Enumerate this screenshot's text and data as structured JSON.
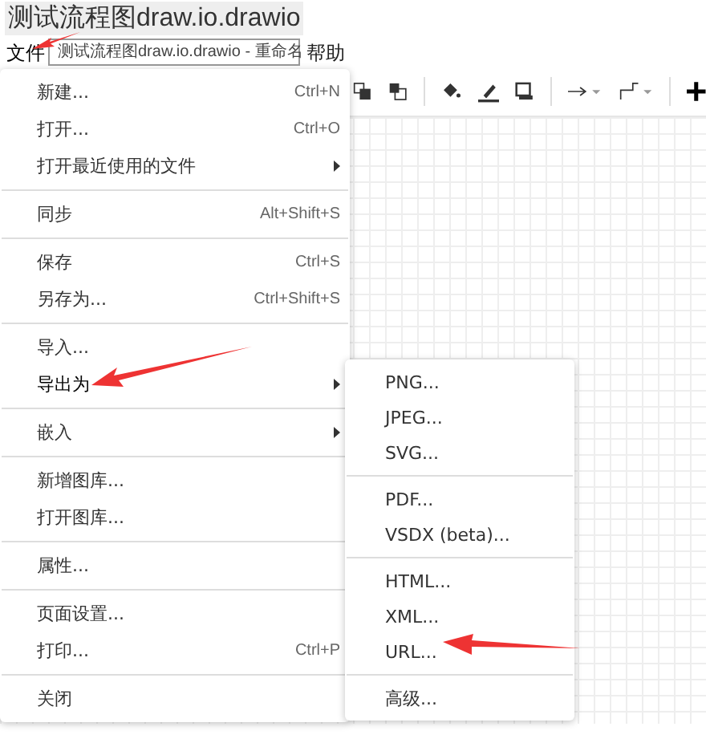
{
  "window": {
    "title": "测试流程图draw.io.drawio"
  },
  "menubar": [
    {
      "label": "文件",
      "selected": true
    },
    {
      "label": "帮助",
      "selected": false
    }
  ],
  "rename_tooltip": "测试流程图draw.io.drawio - 重命名",
  "file_menu": [
    {
      "kind": "item",
      "label": "新建...",
      "shortcut": "Ctrl+N",
      "submenu": false,
      "selected": false
    },
    {
      "kind": "item",
      "label": "打开...",
      "shortcut": "Ctrl+O",
      "submenu": false,
      "selected": false
    },
    {
      "kind": "item",
      "label": "打开最近使用的文件",
      "submenu": true,
      "selected": false
    },
    {
      "kind": "separator"
    },
    {
      "kind": "item",
      "label": "同步",
      "shortcut": "Alt+Shift+S",
      "submenu": false,
      "selected": false
    },
    {
      "kind": "separator"
    },
    {
      "kind": "item",
      "label": "保存",
      "shortcut": "Ctrl+S",
      "submenu": false,
      "selected": false
    },
    {
      "kind": "item",
      "label": "另存为...",
      "shortcut": "Ctrl+Shift+S",
      "submenu": false,
      "selected": false
    },
    {
      "kind": "separator"
    },
    {
      "kind": "item",
      "label": "导入...",
      "submenu": false,
      "selected": false
    },
    {
      "kind": "item",
      "label": "导出为",
      "submenu": true,
      "selected": true
    },
    {
      "kind": "separator"
    },
    {
      "kind": "item",
      "label": "嵌入",
      "submenu": true,
      "selected": false
    },
    {
      "kind": "separator"
    },
    {
      "kind": "item",
      "label": "新增图库...",
      "submenu": false,
      "selected": false
    },
    {
      "kind": "item",
      "label": "打开图库...",
      "submenu": false,
      "selected": false
    },
    {
      "kind": "separator"
    },
    {
      "kind": "item",
      "label": "属性...",
      "submenu": false,
      "selected": false
    },
    {
      "kind": "separator"
    },
    {
      "kind": "item",
      "label": "页面设置...",
      "submenu": false,
      "selected": false
    },
    {
      "kind": "item",
      "label": "打印...",
      "shortcut": "Ctrl+P",
      "submenu": false,
      "selected": false
    },
    {
      "kind": "separator"
    },
    {
      "kind": "item",
      "label": "关闭",
      "submenu": false,
      "selected": false
    }
  ],
  "export_menu": [
    {
      "kind": "item",
      "label": "PNG..."
    },
    {
      "kind": "item",
      "label": "JPEG..."
    },
    {
      "kind": "item",
      "label": "SVG..."
    },
    {
      "kind": "separator"
    },
    {
      "kind": "item",
      "label": "PDF..."
    },
    {
      "kind": "item",
      "label": "VSDX (beta)..."
    },
    {
      "kind": "separator"
    },
    {
      "kind": "item",
      "label": "HTML..."
    },
    {
      "kind": "item",
      "label": "XML..."
    },
    {
      "kind": "item",
      "label": "URL..."
    },
    {
      "kind": "separator"
    },
    {
      "kind": "item",
      "label": "高级..."
    }
  ]
}
